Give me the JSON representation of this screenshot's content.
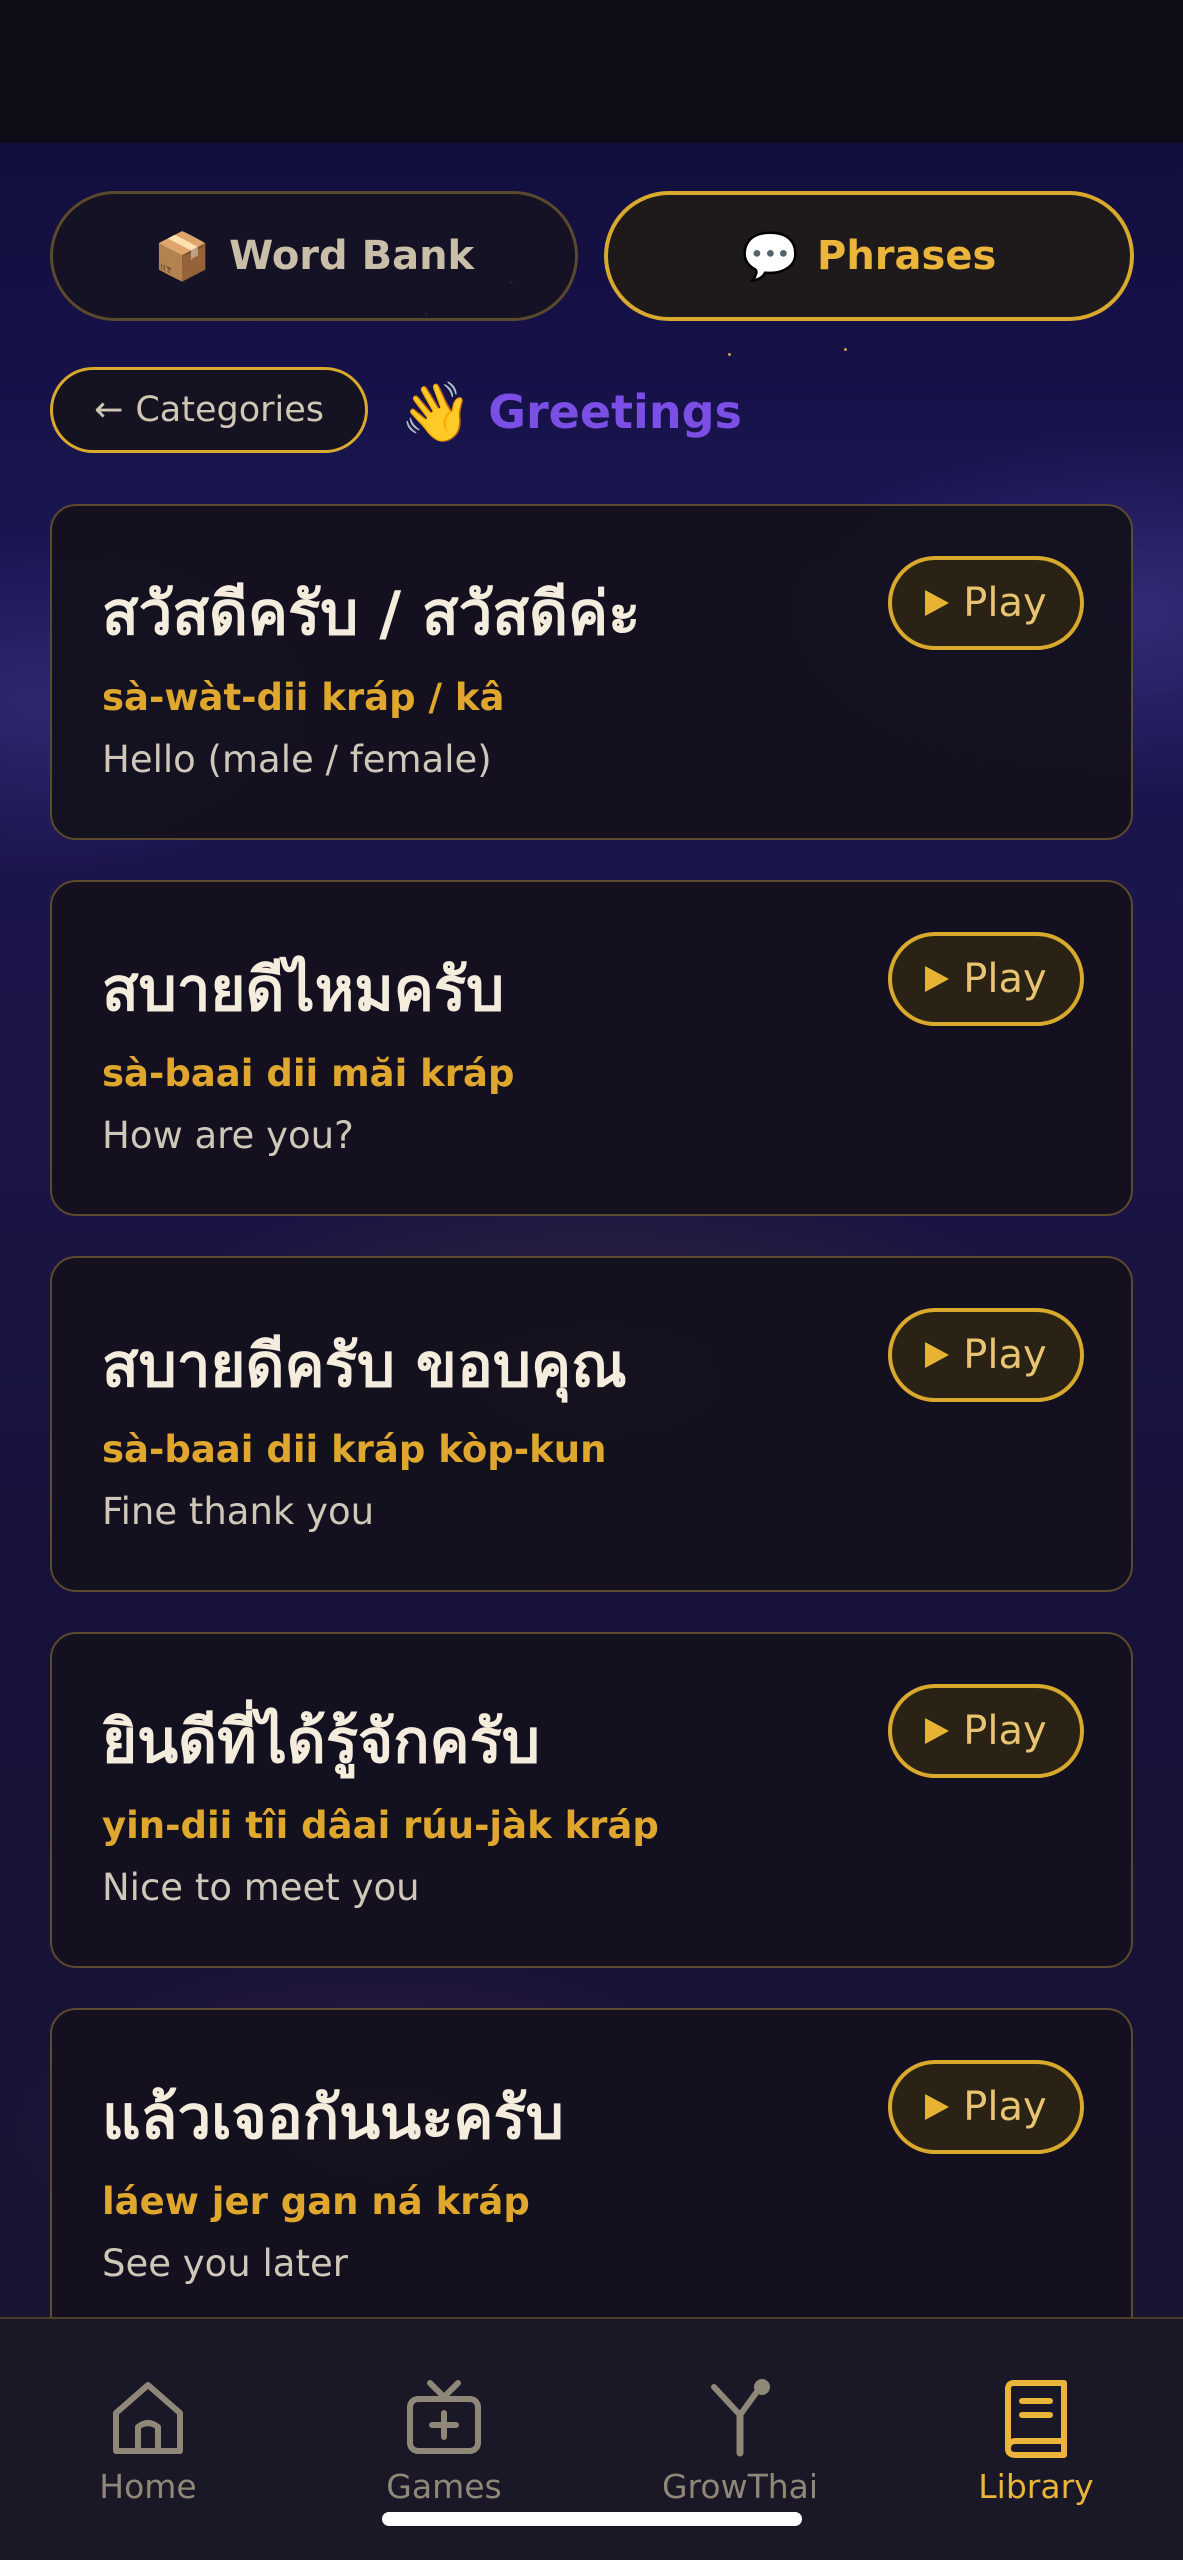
{
  "colors": {
    "accent_gold": "#d8a92d",
    "romanization": "#e0a72f",
    "section_title": "#7b4fe6",
    "card_bg": "#14111e",
    "nav_bg": "#1a1726"
  },
  "top_tabs": [
    {
      "emoji": "📦",
      "label": "Word Bank",
      "active": false
    },
    {
      "emoji": "💬",
      "label": "Phrases",
      "active": true
    }
  ],
  "categories_button": {
    "icon": "arrow-left-icon",
    "arrow": "←",
    "label": "Categories"
  },
  "section": {
    "emoji": "👋",
    "title": "Greetings"
  },
  "phrases": [
    {
      "thai": "สวัสดีครับ / สวัสดีค่ะ",
      "romanization": "sà-wàt-dii kráp / kâ",
      "english": "Hello (male / female)",
      "play_label": "Play"
    },
    {
      "thai": "สบายดีไหมครับ",
      "romanization": "sà-baai dii măi kráp",
      "english": "How are you?",
      "play_label": "Play"
    },
    {
      "thai": "สบายดีครับ ขอบคุณ",
      "romanization": "sà-baai dii kráp kòp-kun",
      "english": "Fine thank you",
      "play_label": "Play"
    },
    {
      "thai": "ยินดีที่ได้รู้จักครับ",
      "romanization": "yin-dii tîi dâai rúu-jàk kráp",
      "english": "Nice to meet you",
      "play_label": "Play"
    },
    {
      "thai": "แล้วเจอกันนะครับ",
      "romanization": "láew jer gan ná kráp",
      "english": "See you later",
      "play_label": "Play"
    }
  ],
  "bottom_nav": [
    {
      "label": "Home",
      "icon": "home-icon",
      "active": false
    },
    {
      "label": "Games",
      "icon": "tv-plus-icon",
      "active": false
    },
    {
      "label": "GrowThai",
      "icon": "sprout-icon",
      "active": false
    },
    {
      "label": "Library",
      "icon": "book-icon",
      "active": true
    }
  ]
}
